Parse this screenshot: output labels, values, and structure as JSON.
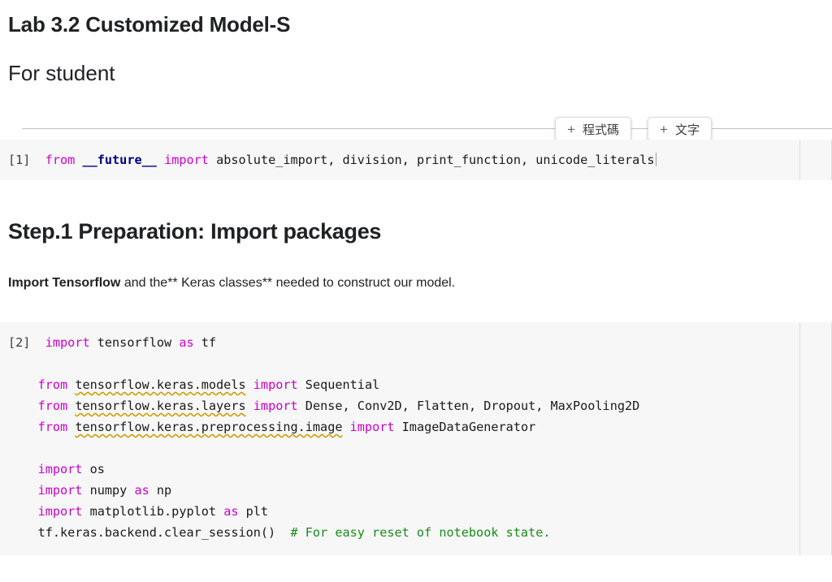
{
  "document": {
    "title": "Lab 3.2 Customized Model-S",
    "subtitle": "For student"
  },
  "insert_toolbar": {
    "plus_glyph": "+",
    "code_button_label": "程式碼",
    "text_button_label": "文字"
  },
  "cells": [
    {
      "prompt": "[1]",
      "type": "code",
      "tokens": [
        {
          "t": "from",
          "c": "kw"
        },
        {
          "t": " ",
          "c": "nm"
        },
        {
          "t": "__future__",
          "c": "blu"
        },
        {
          "t": " ",
          "c": "nm"
        },
        {
          "t": "import",
          "c": "kw"
        },
        {
          "t": " absolute_import, division, print_function, unicode_literals",
          "c": "nm"
        }
      ],
      "plain": "from __future__ import absolute_import, division, print_function, unicode_literals"
    }
  ],
  "section": {
    "heading": "Step.1 Preparation: Import packages",
    "paragraph_bold": "Import Tensorflow",
    "paragraph_rest": " and the** Keras classes** needed to construct our model."
  },
  "code_cell_2": {
    "prompt": "[2]",
    "lines": [
      [
        {
          "t": "import",
          "c": "kw"
        },
        {
          "t": " tensorflow ",
          "c": "nm"
        },
        {
          "t": "as",
          "c": "kw"
        },
        {
          "t": " tf",
          "c": "nm"
        }
      ],
      [],
      [
        {
          "t": "from",
          "c": "kw"
        },
        {
          "t": " ",
          "c": "nm"
        },
        {
          "t": "tensorflow.keras.models",
          "c": "nm sq"
        },
        {
          "t": " ",
          "c": "nm"
        },
        {
          "t": "import",
          "c": "kw"
        },
        {
          "t": " Sequential",
          "c": "nm"
        }
      ],
      [
        {
          "t": "from",
          "c": "kw"
        },
        {
          "t": " ",
          "c": "nm"
        },
        {
          "t": "tensorflow.keras.layers",
          "c": "nm sq"
        },
        {
          "t": " ",
          "c": "nm"
        },
        {
          "t": "import",
          "c": "kw"
        },
        {
          "t": " Dense, Conv2D, Flatten, Dropout, MaxPooling2D",
          "c": "nm"
        }
      ],
      [
        {
          "t": "from",
          "c": "kw"
        },
        {
          "t": " ",
          "c": "nm"
        },
        {
          "t": "tensorflow.keras.preprocessing.image",
          "c": "nm sq"
        },
        {
          "t": " ",
          "c": "nm"
        },
        {
          "t": "import",
          "c": "kw"
        },
        {
          "t": " ImageDataGenerator",
          "c": "nm"
        }
      ],
      [],
      [
        {
          "t": "import",
          "c": "kw"
        },
        {
          "t": " os",
          "c": "nm"
        }
      ],
      [
        {
          "t": "import",
          "c": "kw"
        },
        {
          "t": " numpy ",
          "c": "nm"
        },
        {
          "t": "as",
          "c": "kw"
        },
        {
          "t": " np",
          "c": "nm"
        }
      ],
      [
        {
          "t": "import",
          "c": "kw"
        },
        {
          "t": " matplotlib.pyplot ",
          "c": "nm"
        },
        {
          "t": "as",
          "c": "kw"
        },
        {
          "t": " plt",
          "c": "nm"
        }
      ],
      [
        {
          "t": "tf.keras.backend.clear_session()  ",
          "c": "nm"
        },
        {
          "t": "# For easy reset of notebook state.",
          "c": "cmt"
        }
      ]
    ],
    "plain": "import tensorflow as tf\n\nfrom tensorflow.keras.models import Sequential\nfrom tensorflow.keras.layers import Dense, Conv2D, Flatten, Dropout, MaxPooling2D\nfrom tensorflow.keras.preprocessing.image import ImageDataGenerator\n\nimport os\nimport numpy as np\nimport matplotlib.pyplot as plt\ntf.keras.backend.clear_session()  # For easy reset of notebook state."
  },
  "colors": {
    "keyword": "#cc00cc",
    "module": "#000080",
    "comment": "#1a8c1a",
    "squiggle": "#cc9900",
    "cell_background": "#f7f7f7",
    "rule": "#bdc1c6"
  }
}
